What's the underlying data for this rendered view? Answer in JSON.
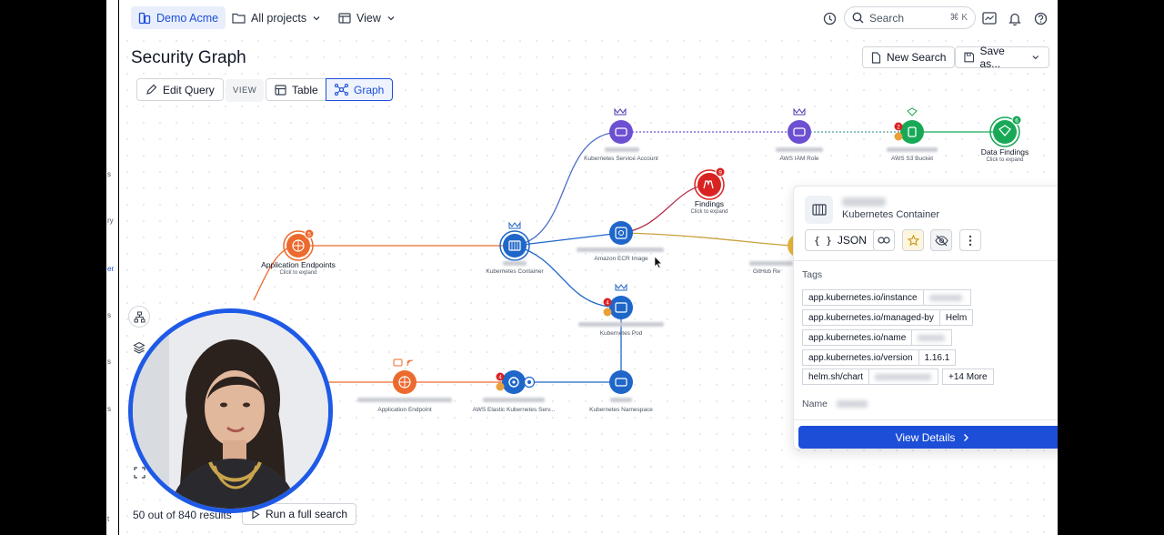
{
  "topbar": {
    "workspace": "Demo Acme",
    "projects": "All projects",
    "view": "View",
    "search_placeholder": "Search",
    "search_shortcut": "⌘ K"
  },
  "page": {
    "title": "Security Graph",
    "new_search": "New Search",
    "save_as": "Save as...",
    "edit_query": "Edit Query",
    "view_label": "VIEW",
    "tab_table": "Table",
    "tab_graph": "Graph"
  },
  "graph": {
    "nodes": [
      {
        "id": "k8s-sa",
        "label": "Kubernetes Service Account",
        "sub": ""
      },
      {
        "id": "iam",
        "label": "AWS IAM Role",
        "sub": ""
      },
      {
        "id": "s3",
        "label": "AWS S3 Bucket",
        "sub": ""
      },
      {
        "id": "data-findings",
        "label": "Data Findings",
        "sub": "Click to expand",
        "badge": "6"
      },
      {
        "id": "findings",
        "label": "Findings",
        "sub": "Click to expand",
        "badge": "9"
      },
      {
        "id": "app-endpoints",
        "label": "Application Endpoints",
        "sub": "Click to expand",
        "badge": "5"
      },
      {
        "id": "k8s-container",
        "label": "Kubernetes Container",
        "sub": ""
      },
      {
        "id": "ecr",
        "label": "Amazon ECR Image",
        "sub": ""
      },
      {
        "id": "github",
        "label": "GitHub Re",
        "sub": ""
      },
      {
        "id": "k8s-pod",
        "label": "Kubernetes Pod",
        "sub": "",
        "badge": "4"
      },
      {
        "id": "app-endpoint",
        "label": "Application Endpoint",
        "sub": ""
      },
      {
        "id": "eks",
        "label": "AWS Elastic Kubernetes Serv...",
        "sub": "",
        "badge": "4"
      },
      {
        "id": "k8s-ns",
        "label": "Kubernetes Namespace",
        "sub": ""
      }
    ],
    "s3_badge": "2"
  },
  "panel": {
    "type": "Kubernetes Container",
    "json_label": "JSON",
    "tags_title": "Tags",
    "tags": [
      {
        "key": "app.kubernetes.io/instance",
        "value": ""
      },
      {
        "key": "app.kubernetes.io/managed-by",
        "value": "Helm"
      },
      {
        "key": "app.kubernetes.io/name",
        "value": ""
      },
      {
        "key": "app.kubernetes.io/version",
        "value": "1.16.1"
      },
      {
        "key": "helm.sh/chart",
        "value": ""
      }
    ],
    "more": "+14 More",
    "name_label": "Name",
    "view_details": "View Details"
  },
  "footer": {
    "results": "50 out of 840 results",
    "run_full": "Run a full search"
  },
  "left_strip": [
    "s",
    "ry",
    "er",
    "s",
    "s",
    "s",
    "t"
  ],
  "colors": {
    "accent": "#1d4ed8",
    "purple": "#6d4fd1",
    "green": "#18a957",
    "red": "#d92323",
    "orange": "#ec6a2d",
    "blue": "#1f66c9"
  }
}
